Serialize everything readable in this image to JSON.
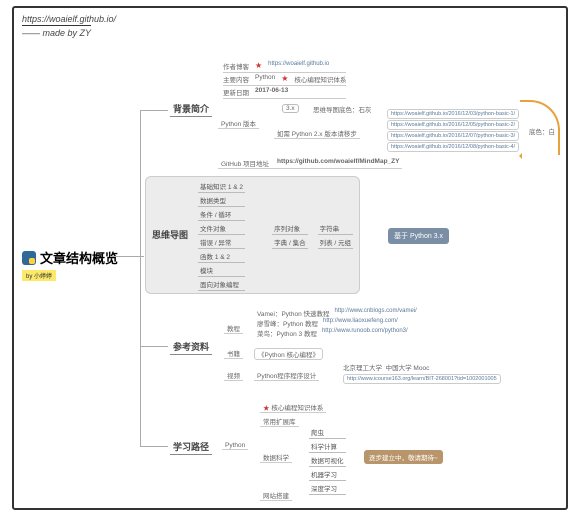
{
  "header": {
    "url": "https://woaielf.github.io/",
    "made": "—— made by ZY"
  },
  "root": {
    "title": "文章结构概览",
    "credit": "by 小婷婷"
  },
  "s1": {
    "title": "背景简介",
    "r1": {
      "k": "作者博客",
      "star": "★",
      "v": "https://woaielf.github.io"
    },
    "r2": {
      "k": "主要内容",
      "v1": "Python",
      "v2": "核心编程知识体系"
    },
    "r3": {
      "k": "更新日期",
      "v": "2017-06-13"
    },
    "r4": {
      "k": "Python 版本",
      "v1": "3.x",
      "note": "思维导图底色：石灰",
      "v2": "如需 Python 2.x 版本请移步"
    },
    "r5": {
      "k": "GitHub 项目地址",
      "v": "https://github.com/woaielf/MindMap_ZY"
    },
    "links": [
      "https://woaielf.github.io/2016/12/03/python-basic-1/",
      "https://woaielf.github.io/2016/12/05/python-basic-2/",
      "https://woaielf.github.io/2016/12/07/python-basic-3/",
      "https://woaielf.github.io/2016/12/08/python-basic-4/"
    ],
    "side": "底色：白"
  },
  "s2": {
    "title": "思维导图",
    "items": [
      "基础知识 1 & 2",
      "数据类型",
      "条件 / 循环",
      "文件对象",
      "错误 / 异常",
      "函数 1 & 2",
      "模块",
      "面向对象编程"
    ],
    "sub": {
      "k": "序列对象",
      "a": "字符串",
      "b": "列表 / 元组",
      "c": "字典 / 集合"
    },
    "badge": "基于 Python 3.x"
  },
  "s3": {
    "title": "参考资料",
    "r1": {
      "k": "教程",
      "a": "Vamei：Python 快速教程",
      "al": "http://www.cnblogs.com/vamei/",
      "b": "廖雪峰：Python 教程",
      "bl": "http://www.liaoxuefeng.com/",
      "c": "菜鸟：Python 3 教程",
      "cl": "http://www.runoob.com/python3/"
    },
    "r2": {
      "k": "书籍",
      "v": "《Python 核心编程》"
    },
    "r3": {
      "k": "视频",
      "v": "Python程序程序设计",
      "a": "北京理工大学",
      "b": "中国大学 Mooc",
      "l": "http://www.icourse163.org/learn/BIT-268001?tid=1002001005"
    }
  },
  "s4": {
    "title": "学习路径",
    "r1": "核心编程知识体系",
    "r2": "常用扩展库",
    "k": "Python",
    "sub": "数据科学",
    "items": [
      "爬虫",
      "科学计算",
      "数据可视化",
      "机器学习",
      "深度学习"
    ],
    "r3": "网站搭建",
    "badge": "逐步建立中，敬请期待~"
  }
}
